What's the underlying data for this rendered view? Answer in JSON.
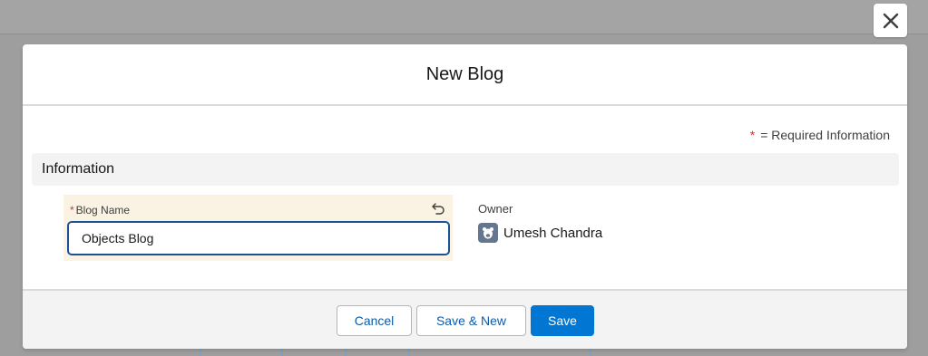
{
  "modal": {
    "title": "New Blog"
  },
  "form": {
    "required_star": "*",
    "required_legend": "= Required Information",
    "section_title": "Information",
    "blog_name": {
      "required_star": "*",
      "label": "Blog Name",
      "value": "Objects Blog"
    },
    "owner": {
      "label": "Owner",
      "value": "Umesh Chandra"
    }
  },
  "footer": {
    "cancel_label": "Cancel",
    "save_new_label": "Save & New",
    "save_label": "Save"
  },
  "icons": {
    "close": "close-icon",
    "undo": "undo-icon",
    "avatar": "user-avatar-icon"
  },
  "colors": {
    "brand": "#0176d3",
    "required": "#c23934",
    "edited_field_bg": "#faf3e3",
    "input_focus_border": "#1b5297"
  }
}
